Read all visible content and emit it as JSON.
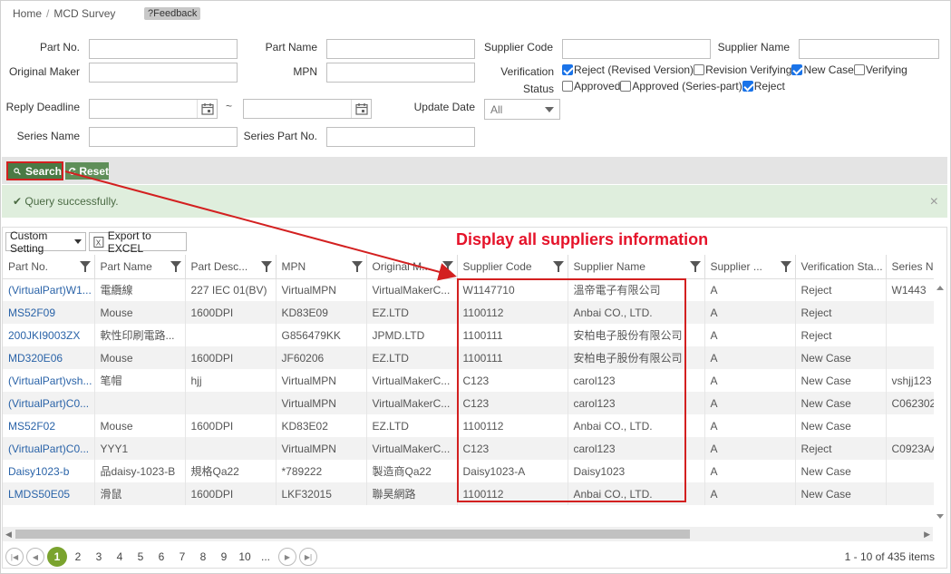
{
  "breadcrumb": {
    "home": "Home",
    "sep": "/",
    "current": "MCD Survey"
  },
  "feedback_label": "?Feedback",
  "form": {
    "part_no": "Part No.",
    "part_name": "Part Name",
    "supplier_code": "Supplier Code",
    "supplier_name": "Supplier Name",
    "original_maker": "Original Maker",
    "mpn": "MPN",
    "verification": "Verification",
    "status": "Status",
    "reply_deadline": "Reply Deadline",
    "tilde": "~",
    "update_date": "Update Date",
    "update_date_value": "All",
    "series_name": "Series Name",
    "series_part_no": "Series Part No."
  },
  "verification_options": [
    {
      "label": "Reject (Revised Version)",
      "checked": true
    },
    {
      "label": "Revision Verifying",
      "checked": false
    },
    {
      "label": "New Case",
      "checked": true
    },
    {
      "label": "Verifying",
      "checked": false
    },
    {
      "label": "Approved",
      "checked": false
    },
    {
      "label": "Approved (Series-part)",
      "checked": false
    },
    {
      "label": "Reject",
      "checked": true
    }
  ],
  "buttons": {
    "search": "Search",
    "reset": "Reset"
  },
  "alert": {
    "message": "Query successfully.",
    "close": "×"
  },
  "grid_toolbar": {
    "custom_setting": "Custom Setting",
    "export": "Export to EXCEL"
  },
  "annotation": "Display all suppliers information",
  "table": {
    "columns": [
      "Part No.",
      "Part Name",
      "Part Desc...",
      "MPN",
      "Original M...",
      "Supplier Code",
      "Supplier Name",
      "Supplier ...",
      "Verification Sta...",
      "Series N"
    ],
    "rows": [
      [
        "(VirtualPart)W1...",
        "電纜線",
        "227 IEC 01(BV)",
        "VirtualMPN",
        "VirtualMakerC...",
        "W1147710",
        "溫帝電子有限公司",
        "A",
        "Reject",
        "W1443"
      ],
      [
        "MS52F09",
        "Mouse",
        "1600DPI",
        "KD83E09",
        "EZ.LTD",
        "1100112",
        "Anbai CO., LTD.",
        "A",
        "Reject",
        ""
      ],
      [
        "200JKI9003ZX",
        "軟性印刷電路...",
        "",
        "G856479KK",
        "JPMD.LTD",
        "1100111",
        "安柏电子股份有限公司",
        "A",
        "Reject",
        ""
      ],
      [
        "MD320E06",
        "Mouse",
        "1600DPI",
        "JF60206",
        "EZ.LTD",
        "1100111",
        "安柏电子股份有限公司",
        "A",
        "New Case",
        ""
      ],
      [
        "(VirtualPart)vsh...",
        "笔帽",
        "hjj",
        "VirtualMPN",
        "VirtualMakerC...",
        "C123",
        "carol123",
        "A",
        "New Case",
        "vshjj123"
      ],
      [
        "(VirtualPart)C0...",
        "",
        "",
        "VirtualMPN",
        "VirtualMakerC...",
        "C123",
        "carol123",
        "A",
        "New Case",
        "C062302"
      ],
      [
        "MS52F02",
        "Mouse",
        "1600DPI",
        "KD83E02",
        "EZ.LTD",
        "1100112",
        "Anbai CO., LTD.",
        "A",
        "New Case",
        ""
      ],
      [
        "(VirtualPart)C0...",
        "YYY1",
        "",
        "VirtualMPN",
        "VirtualMakerC...",
        "C123",
        "carol123",
        "A",
        "Reject",
        "C0923AA"
      ],
      [
        "Daisy1023-b",
        "品daisy-1023-B",
        "規格Qa22",
        "*789222",
        "製造商Qa22",
        "Daisy1023-A",
        "Daisy1023",
        "A",
        "New Case",
        ""
      ],
      [
        "LMDS50E05",
        "滑鼠",
        "1600DPI",
        "LKF32015",
        "聯昊網路",
        "1100112",
        "Anbai CO., LTD.",
        "A",
        "New Case",
        ""
      ]
    ]
  },
  "pager": {
    "pages": [
      "1",
      "2",
      "3",
      "4",
      "5",
      "6",
      "7",
      "8",
      "9",
      "10",
      "..."
    ],
    "current": "1",
    "info": "1 - 10 of 435 items"
  },
  "colors": {
    "accent_green": "#4a7a45",
    "annotation_red": "#e5132a",
    "link_blue": "#2a63a8",
    "pager_active": "#7aa32e"
  }
}
